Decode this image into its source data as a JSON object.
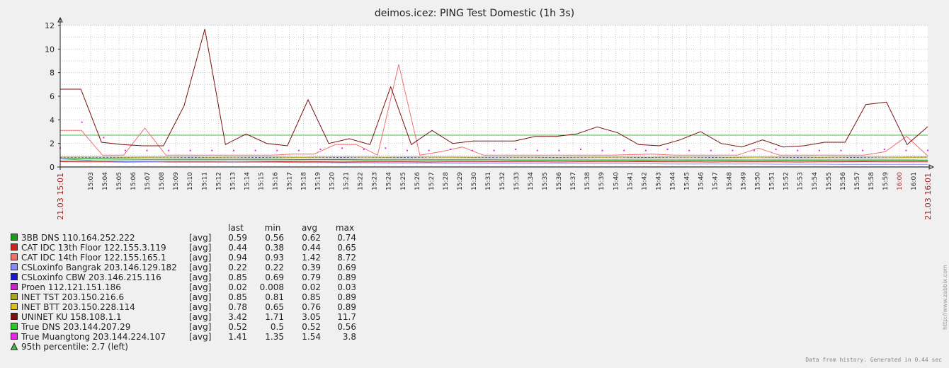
{
  "chart_data": {
    "type": "line",
    "title": "deimos.icez: PING Test Domestic  (1h 3s)",
    "y_ticks": [
      "0",
      "2",
      "4",
      "6",
      "8",
      "10",
      "12"
    ],
    "ylim": [
      0,
      12
    ],
    "grid": true,
    "x_start_label": "21.03 15:01",
    "x_end_label": "21.03 16:01",
    "x_tick_labels": [
      "15:03",
      "15:04",
      "15:05",
      "15:06",
      "15:07",
      "15:08",
      "15:09",
      "15:10",
      "15:11",
      "15:12",
      "15:13",
      "15:14",
      "15:15",
      "15:16",
      "15:17",
      "15:18",
      "15:19",
      "15:20",
      "15:21",
      "15:22",
      "15:23",
      "15:24",
      "15:25",
      "15:26",
      "15:27",
      "15:28",
      "15:29",
      "15:30",
      "15:31",
      "15:32",
      "15:33",
      "15:34",
      "15:35",
      "15:36",
      "15:37",
      "15:38",
      "15:39",
      "15:40",
      "15:41",
      "15:42",
      "15:43",
      "15:44",
      "15:45",
      "15:46",
      "15:47",
      "15:48",
      "15:49",
      "15:50",
      "15:51",
      "15:52",
      "15:53",
      "15:54",
      "15:55",
      "15:56",
      "15:57",
      "15:58",
      "15:59",
      "16:00",
      "16:01"
    ],
    "x_highlight_label": "16:00",
    "legend_headers": [
      "last",
      "min",
      "avg",
      "max"
    ],
    "series": [
      {
        "name": "3BB DNS 110.164.252.222",
        "func": "[avg]",
        "last": "0.59",
        "min": "0.56",
        "avg": "0.62",
        "max": "0.74",
        "color": "#1a9e1a",
        "dashed": false,
        "values": [
          0.7,
          0.7,
          0.68,
          0.66,
          0.65,
          0.64,
          0.64,
          0.64,
          0.64,
          0.64,
          0.64,
          0.63,
          0.63,
          0.63,
          0.62,
          0.62,
          0.62,
          0.61,
          0.61,
          0.61,
          0.61,
          0.6,
          0.6,
          0.6,
          0.6,
          0.6,
          0.6,
          0.6,
          0.6,
          0.6,
          0.6,
          0.6,
          0.6,
          0.6,
          0.6,
          0.6,
          0.6,
          0.6,
          0.6,
          0.6,
          0.59
        ]
      },
      {
        "name": "CAT IDC 13th Floor 122.155.3.119",
        "func": "[avg]",
        "last": "0.44",
        "min": "0.38",
        "avg": "0.44",
        "max": "0.65",
        "color": "#cc2222",
        "dashed": false,
        "values": [
          0.45,
          0.44,
          0.43,
          0.42,
          0.44,
          0.43,
          0.44,
          0.43,
          0.42,
          0.44,
          0.45,
          0.43,
          0.44,
          0.42,
          0.44,
          0.43,
          0.44,
          0.42,
          0.43,
          0.44,
          0.44,
          0.43,
          0.44,
          0.42,
          0.44,
          0.43,
          0.44,
          0.45,
          0.43,
          0.44,
          0.42,
          0.44,
          0.43,
          0.44,
          0.42,
          0.43,
          0.44,
          0.45,
          0.43,
          0.44,
          0.44
        ]
      },
      {
        "name": "CAT IDC 14th Floor 122.155.165.1",
        "func": "[avg]",
        "last": "0.94",
        "min": "0.93",
        "avg": "1.42",
        "max": "8.72",
        "color": "#f07070",
        "dashed": false,
        "values": [
          3.1,
          3.1,
          1.0,
          1.0,
          3.3,
          1.0,
          1.0,
          1.0,
          1.0,
          1.0,
          1.0,
          1.1,
          1.1,
          1.9,
          1.9,
          1.0,
          8.7,
          1.0,
          1.3,
          1.7,
          1.0,
          1.0,
          1.0,
          1.0,
          1.0,
          1.0,
          1.0,
          1.05,
          1.1,
          1.0,
          1.0,
          1.0,
          1.0,
          1.6,
          1.0,
          1.0,
          1.0,
          1.0,
          1.0,
          1.3,
          2.6,
          0.94
        ]
      },
      {
        "name": "CSLoxinfo Bangrak 203.146.129.182",
        "func": "[avg]",
        "last": "0.22",
        "min": "0.22",
        "avg": "0.39",
        "max": "0.69",
        "color": "#8888ff",
        "dashed": false,
        "values": [
          0.69,
          0.6,
          0.5,
          0.45,
          0.45,
          0.4,
          0.4,
          0.4,
          0.4,
          0.4,
          0.4,
          0.38,
          0.38,
          0.36,
          0.36,
          0.35,
          0.34,
          0.34,
          0.33,
          0.32,
          0.32,
          0.3,
          0.3,
          0.3,
          0.28,
          0.28,
          0.28,
          0.28,
          0.26,
          0.26,
          0.25,
          0.25,
          0.25,
          0.24,
          0.24,
          0.24,
          0.23,
          0.23,
          0.23,
          0.22,
          0.22
        ]
      },
      {
        "name": "CSLoxinfo CBW 203.146.215.116",
        "func": "[avg]",
        "last": "0.85",
        "min": "0.69",
        "avg": "0.79",
        "max": "0.89",
        "color": "#1a1acc",
        "dashed": true,
        "values": [
          0.8,
          0.8,
          0.78,
          0.79,
          0.8,
          0.78,
          0.79,
          0.8,
          0.78,
          0.79,
          0.8,
          0.78,
          0.79,
          0.8,
          0.78,
          0.79,
          0.8,
          0.78,
          0.79,
          0.8,
          0.78,
          0.79,
          0.8,
          0.78,
          0.79,
          0.8,
          0.78,
          0.79,
          0.8,
          0.78,
          0.79,
          0.8,
          0.78,
          0.79,
          0.8,
          0.78,
          0.79,
          0.82,
          0.84,
          0.85,
          0.85
        ]
      },
      {
        "name": "Proen 112.121.151.186",
        "func": "[avg]",
        "last": "0.02",
        "min": "0.008",
        "avg": "0.02",
        "max": "0.03",
        "color": "#cc22cc",
        "dashed": false,
        "values": [
          0.02,
          0.02,
          0.02,
          0.02,
          0.02,
          0.02,
          0.02,
          0.02,
          0.02,
          0.02,
          0.02,
          0.02,
          0.02,
          0.02,
          0.02,
          0.02,
          0.02,
          0.02,
          0.02,
          0.02,
          0.02,
          0.02,
          0.02,
          0.02,
          0.02,
          0.02,
          0.02,
          0.02,
          0.02,
          0.02,
          0.02,
          0.02,
          0.02,
          0.02,
          0.02,
          0.02,
          0.02,
          0.02,
          0.02,
          0.02,
          0.02
        ]
      },
      {
        "name": "INET TST 203.150.216.6",
        "func": "[avg]",
        "last": "0.85",
        "min": "0.81",
        "avg": "0.85",
        "max": "0.89",
        "color": "#a8a818",
        "dashed": false,
        "values": [
          0.85,
          0.86,
          0.85,
          0.84,
          0.85,
          0.86,
          0.85,
          0.84,
          0.85,
          0.86,
          0.85,
          0.84,
          0.85,
          0.86,
          0.85,
          0.84,
          0.85,
          0.86,
          0.85,
          0.84,
          0.85,
          0.86,
          0.85,
          0.84,
          0.85,
          0.86,
          0.85,
          0.84,
          0.85,
          0.86,
          0.85,
          0.84,
          0.85,
          0.86,
          0.85,
          0.84,
          0.85,
          0.86,
          0.85,
          0.84,
          0.85
        ]
      },
      {
        "name": "INET BTT 203.150.228.114",
        "func": "[avg]",
        "last": "0.78",
        "min": "0.65",
        "avg": "0.76",
        "max": "0.89",
        "color": "#d8c020",
        "dashed": false,
        "values": [
          0.76,
          0.77,
          0.75,
          0.76,
          0.78,
          0.76,
          0.75,
          0.77,
          0.76,
          0.75,
          0.76,
          0.78,
          0.76,
          0.75,
          0.77,
          0.76,
          0.75,
          0.76,
          0.78,
          0.76,
          0.75,
          0.77,
          0.76,
          0.75,
          0.76,
          0.78,
          0.76,
          0.75,
          0.77,
          0.76,
          0.75,
          0.76,
          0.78,
          0.76,
          0.75,
          0.77,
          0.76,
          0.75,
          0.76,
          0.78,
          0.78
        ]
      },
      {
        "name": "UNINET KU 158.108.1.1",
        "func": "[avg]",
        "last": "3.42",
        "min": "1.71",
        "avg": "3.05",
        "max": "11.7",
        "color": "#7a1010",
        "dashed": false,
        "values": [
          6.6,
          6.6,
          2.1,
          1.9,
          1.8,
          1.8,
          5.2,
          11.7,
          1.9,
          2.8,
          2.0,
          1.8,
          5.7,
          2.0,
          2.4,
          1.9,
          6.8,
          1.9,
          3.1,
          2.0,
          2.2,
          2.2,
          2.2,
          2.6,
          2.6,
          2.8,
          3.4,
          2.9,
          1.9,
          1.8,
          2.3,
          3.0,
          2.0,
          1.7,
          2.3,
          1.7,
          1.8,
          2.1,
          2.1,
          5.3,
          5.5,
          1.9,
          3.42
        ]
      },
      {
        "name": "True DNS 203.144.207.29",
        "func": "[avg]",
        "last": "0.52",
        "min": "0.5",
        "avg": "0.52",
        "max": "0.56",
        "color": "#22cc22",
        "dashed": false,
        "values": [
          0.53,
          0.52,
          0.52,
          0.53,
          0.51,
          0.52,
          0.53,
          0.52,
          0.51,
          0.52,
          0.53,
          0.52,
          0.51,
          0.52,
          0.53,
          0.52,
          0.51,
          0.52,
          0.53,
          0.52,
          0.51,
          0.52,
          0.53,
          0.52,
          0.51,
          0.52,
          0.53,
          0.52,
          0.51,
          0.52,
          0.53,
          0.52,
          0.51,
          0.52,
          0.53,
          0.52,
          0.51,
          0.52,
          0.53,
          0.52,
          0.52
        ]
      },
      {
        "name": "True Muangtong 203.144.224.107",
        "func": "[avg]",
        "last": "1.41",
        "min": "1.35",
        "avg": "1.54",
        "max": "3.8",
        "color": "#ee22ee",
        "dashed": false,
        "dots": true,
        "values": [
          1.6,
          3.8,
          2.5,
          1.4,
          1.4,
          1.4,
          1.4,
          1.4,
          1.4,
          1.4,
          1.4,
          1.4,
          1.5,
          1.6,
          1.5,
          1.6,
          1.4,
          1.4,
          1.5,
          1.4,
          1.4,
          1.5,
          1.4,
          1.4,
          1.5,
          1.4,
          1.4,
          1.4,
          1.5,
          1.4,
          1.4,
          1.4,
          1.4,
          1.5,
          1.4,
          1.4,
          1.4,
          1.4,
          1.5,
          1.4,
          1.41
        ]
      }
    ],
    "percentile": {
      "label": "95th percentile: 2.7  (left)",
      "value": 2.7,
      "color": "#44bb44"
    },
    "footer_vertical": "http://www.zabbix.com",
    "footer_note": "Data from history. Generated in 0.44 sec"
  }
}
